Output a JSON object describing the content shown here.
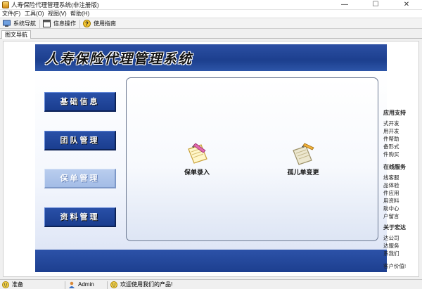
{
  "window": {
    "title": "人寿保险代理管理系统(非注册版)",
    "controls": {
      "minimize": "—",
      "maximize": "☐",
      "close": "✕"
    }
  },
  "menu": [
    "文件(F)",
    "工具(O)",
    "视图(V)",
    "帮助(H)"
  ],
  "toolbar": [
    {
      "label": "系统导航",
      "icon": "monitor-icon"
    },
    {
      "label": "信息操作",
      "icon": "window-icon"
    },
    {
      "label": "使用指南",
      "icon": "help-icon"
    }
  ],
  "tabs": [
    "图文导航"
  ],
  "banner": {
    "title": "人寿保险代理管理系统"
  },
  "nav": [
    {
      "label": "基础信息"
    },
    {
      "label": "团队管理"
    },
    {
      "label": "保单管理",
      "active": true
    },
    {
      "label": "资料管理"
    }
  ],
  "features": [
    {
      "label": "保单录入",
      "icon": "policy-entry-icon"
    },
    {
      "label": "孤儿单变更",
      "icon": "orphan-policy-change-icon"
    }
  ],
  "side_links": [
    {
      "text": "应用支持",
      "heading": true
    },
    {
      "text": "式开发"
    },
    {
      "text": "用开发"
    },
    {
      "text": "件帮助"
    },
    {
      "text": "备形式"
    },
    {
      "text": "件购买"
    },
    {
      "text": "在线服务",
      "heading": true
    },
    {
      "text": "线客服"
    },
    {
      "text": "品体验"
    },
    {
      "text": "件应用"
    },
    {
      "text": "用资料"
    },
    {
      "text": "助中心"
    },
    {
      "text": "户留言"
    },
    {
      "text": "关于宏达",
      "heading": true
    },
    {
      "text": "达公司"
    },
    {
      "text": "达服务"
    },
    {
      "text": "系我们"
    },
    {
      "text": "客户价值!"
    }
  ],
  "status": [
    {
      "text": "准备",
      "icon": "status-ready-icon"
    },
    {
      "text": "Admin",
      "icon": "user-icon"
    },
    {
      "text": "欢迎使用我们的产品!",
      "icon": "welcome-icon"
    }
  ],
  "colors": {
    "banner_blue": "#1c3f8e",
    "nav_button_blue": "#2950a8",
    "nav_button_active": "#b9cdee"
  }
}
